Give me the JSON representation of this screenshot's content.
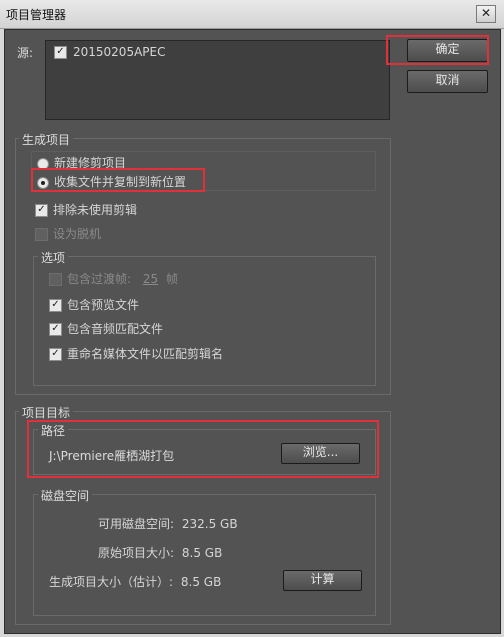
{
  "window": {
    "title": "项目管理器",
    "close_glyph": "✕"
  },
  "source": {
    "label": "源:",
    "items": [
      {
        "checked": true,
        "name": "20150205APEC"
      }
    ]
  },
  "buttons": {
    "ok": "确定",
    "cancel": "取消"
  },
  "generate": {
    "title": "生成项目",
    "options": [
      {
        "label": "新建修剪项目",
        "selected": false
      },
      {
        "label": "收集文件并复制到新位置",
        "selected": true
      }
    ],
    "exclude_unused": {
      "label": "排除未使用剪辑",
      "checked": true
    },
    "make_offline": {
      "label": "设为脱机",
      "checked": false,
      "disabled": true
    }
  },
  "options_group": {
    "title": "选项",
    "include_handles": {
      "label": "包含过渡帧:",
      "value": "25",
      "unit": "帧",
      "checked": false,
      "disabled": true
    },
    "include_preview": {
      "label": "包含预览文件",
      "checked": true
    },
    "include_audio": {
      "label": "包含音频匹配文件",
      "checked": true
    },
    "rename_media": {
      "label": "重命名媒体文件以匹配剪辑名",
      "checked": true
    }
  },
  "target": {
    "title": "项目目标",
    "path_title": "路径",
    "path_value": "J:\\Premiere雁栖湖打包",
    "browse": "浏览..."
  },
  "disk": {
    "title": "磁盘空间",
    "available_label": "可用磁盘空间:",
    "available_value": "232.5 GB",
    "original_label": "原始项目大小:",
    "original_value": "8.5 GB",
    "result_label": "生成项目大小（估计）:",
    "result_value": "8.5 GB",
    "compute": "计算"
  },
  "colors": {
    "panel_bg": "#535353",
    "highlight": "#e0303a"
  }
}
